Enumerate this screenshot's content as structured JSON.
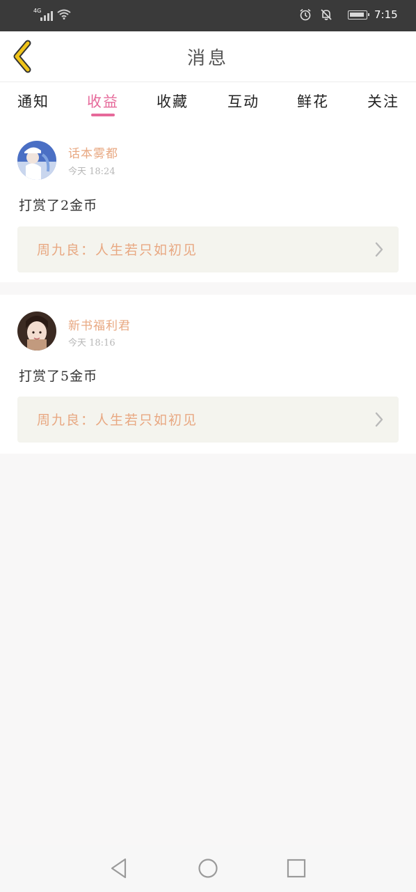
{
  "status_bar": {
    "network": "4G",
    "time": "7:15",
    "icons": [
      "signal-icon",
      "wifi-icon",
      "alarm-icon",
      "bell-off-icon",
      "battery-icon"
    ]
  },
  "header": {
    "title": "消息",
    "back_icon": "chevron-left-icon",
    "accent_color": "#f0c419"
  },
  "tabs": {
    "items": [
      "通知",
      "收益",
      "收藏",
      "互动",
      "鲜花",
      "关注"
    ],
    "active": "收益",
    "active_color": "#e6699a"
  },
  "messages": [
    {
      "username": "话本雾都",
      "time": "今天 18:24",
      "text": "打赏了2金币",
      "book": "周九良：人生若只如初见",
      "avatar_icon": "avatar"
    },
    {
      "username": "新书福利君",
      "time": "今天 18:16",
      "text": "打赏了5金币",
      "book": "周九良：人生若只如初见",
      "avatar_icon": "avatar"
    }
  ],
  "navbar": {
    "icons": [
      "back-triangle-icon",
      "home-circle-icon",
      "recent-square-icon"
    ]
  },
  "colors": {
    "username": "#e8a882",
    "book_card_bg": "#f4f4ee",
    "status_bar_bg": "#3a3a3a"
  }
}
